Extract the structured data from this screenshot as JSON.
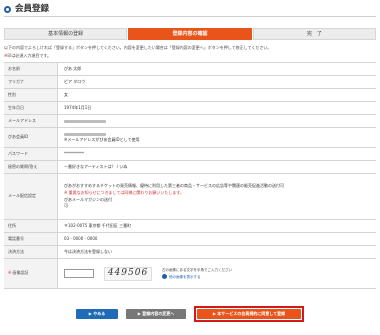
{
  "header": {
    "title": "会員登録"
  },
  "steps": [
    {
      "label": "基本情報の登録"
    },
    {
      "label": "登録内容の確認"
    },
    {
      "label": "完　了"
    }
  ],
  "intro": "以下の内容でよろしければ「登録する」ボタンを押してください。内容を変更したい場合は「登録内容の変更へ」ボタンを押して修正してください。",
  "required_note": {
    "mark": "※",
    "text": "印は必須入力項目です。"
  },
  "form": {
    "name": {
      "label": "お名前",
      "value": "ぴあ 太郎"
    },
    "furigana": {
      "label": "フリガナ",
      "value": "ピア タロウ"
    },
    "gender": {
      "label": "性別",
      "value": "女"
    },
    "birthday": {
      "label": "生年月日",
      "value": "1974年1月1日"
    },
    "email": {
      "label": "メールアドレス"
    },
    "pia_id": {
      "label": "ぴあ会員ID",
      "note": "※メールアドレスがぴあ会員IDとして使用"
    },
    "password": {
      "label": "パスワード",
      "value": "**********"
    },
    "secret": {
      "label": "秘密の質問/答え",
      "value": "一番好きなアーティストは？ / いぬ"
    },
    "mail_settings": {
      "label": "メール配信設定",
      "line1": "ぴあがおすすめするチケットの発売情報、優待に利用した第三者の商品・サービスの広告等や関連の販売促進活動の送付可",
      "line2": "※ 重要なお知らせにつきましては同様に関わりお願いいたします。",
      "line3": "ぴあメールマガジンの送付",
      "line4": "可"
    },
    "address": {
      "label": "住所",
      "value": "〒102-0075 東京都 千代田区 三番町"
    },
    "phone": {
      "label": "電話番号",
      "value": "03 - 0000 - 0000"
    },
    "payment": {
      "label": "決済方法",
      "value": "今は決済方法を登録しない"
    },
    "auth": {
      "mark": "※",
      "label": "画像認証",
      "captcha_text": "449506",
      "help_text": "左の画像にある文字を半角でご入力ください",
      "refresh_link": "他の画像を表示する"
    }
  },
  "buttons": {
    "cancel": "▶ やめる",
    "edit": "▶ 登録内容の変更へ",
    "register": "▶ 本サービスの会員規約に同意して登録"
  },
  "colors": {
    "accent": "#e8541a",
    "link": "#1f5fa8",
    "highlight": "#d21a1a"
  }
}
